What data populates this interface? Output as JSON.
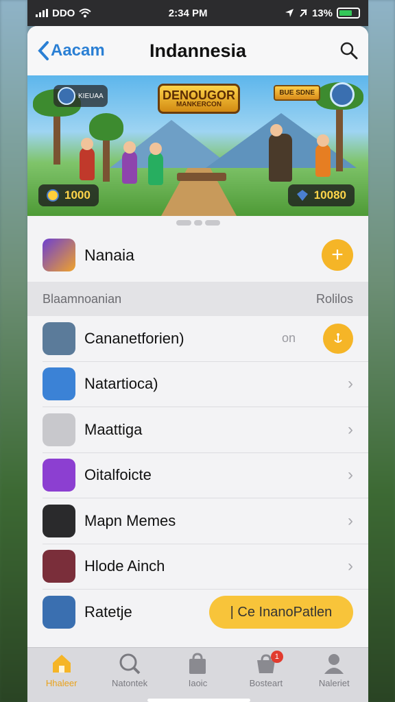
{
  "status_bar": {
    "carrier": "DDO",
    "time": "2:34 PM",
    "battery": "13%"
  },
  "nav": {
    "back_label": "Aacam",
    "title": "Indannesia"
  },
  "banner": {
    "logo_title": "DENOUGOR",
    "logo_subtitle": "MANKERCON",
    "left_chip": "KIEUAA",
    "right_tag": "BUE SDNE",
    "score_left": "1000",
    "score_right": "10080"
  },
  "featured": {
    "label": "Nanaia",
    "action": "+"
  },
  "section": {
    "title": "Blaamnoanian",
    "action": "Rolilos"
  },
  "items": [
    {
      "label": "Cananetforien)",
      "extra": "on",
      "accessory": "toggle",
      "icon_color": "#5b7b9a"
    },
    {
      "label": "Natartioca)",
      "accessory": "chevron",
      "icon_color": "#3b82d6"
    },
    {
      "label": "Maattiga",
      "accessory": "chevron",
      "icon_color": "#c8c8cc"
    },
    {
      "label": "Oitalfoicte",
      "accessory": "chevron",
      "icon_color": "#8c3fd1"
    },
    {
      "label": "Mapn Memes",
      "accessory": "chevron",
      "icon_color": "#2a2a2c"
    },
    {
      "label": "Hlode Ainch",
      "accessory": "chevron",
      "icon_color": "#7a2e3a"
    },
    {
      "label": "Ratetje",
      "accessory": "cta",
      "cta_label": "| Ce InanoPatlen",
      "icon_color": "#3a6fb0"
    }
  ],
  "tabs": [
    {
      "label": "Hhaleer",
      "active": true,
      "icon": "home-icon"
    },
    {
      "label": "Natontek",
      "active": false,
      "icon": "search-icon"
    },
    {
      "label": "Iaoic",
      "active": false,
      "icon": "bag-icon"
    },
    {
      "label": "Bosteart",
      "active": false,
      "icon": "cart-icon",
      "badge": "1"
    },
    {
      "label": "Naleriet",
      "active": false,
      "icon": "profile-icon"
    }
  ],
  "colors": {
    "accent": "#f5b527",
    "link": "#2a7fd4",
    "badge": "#e23b2e"
  }
}
